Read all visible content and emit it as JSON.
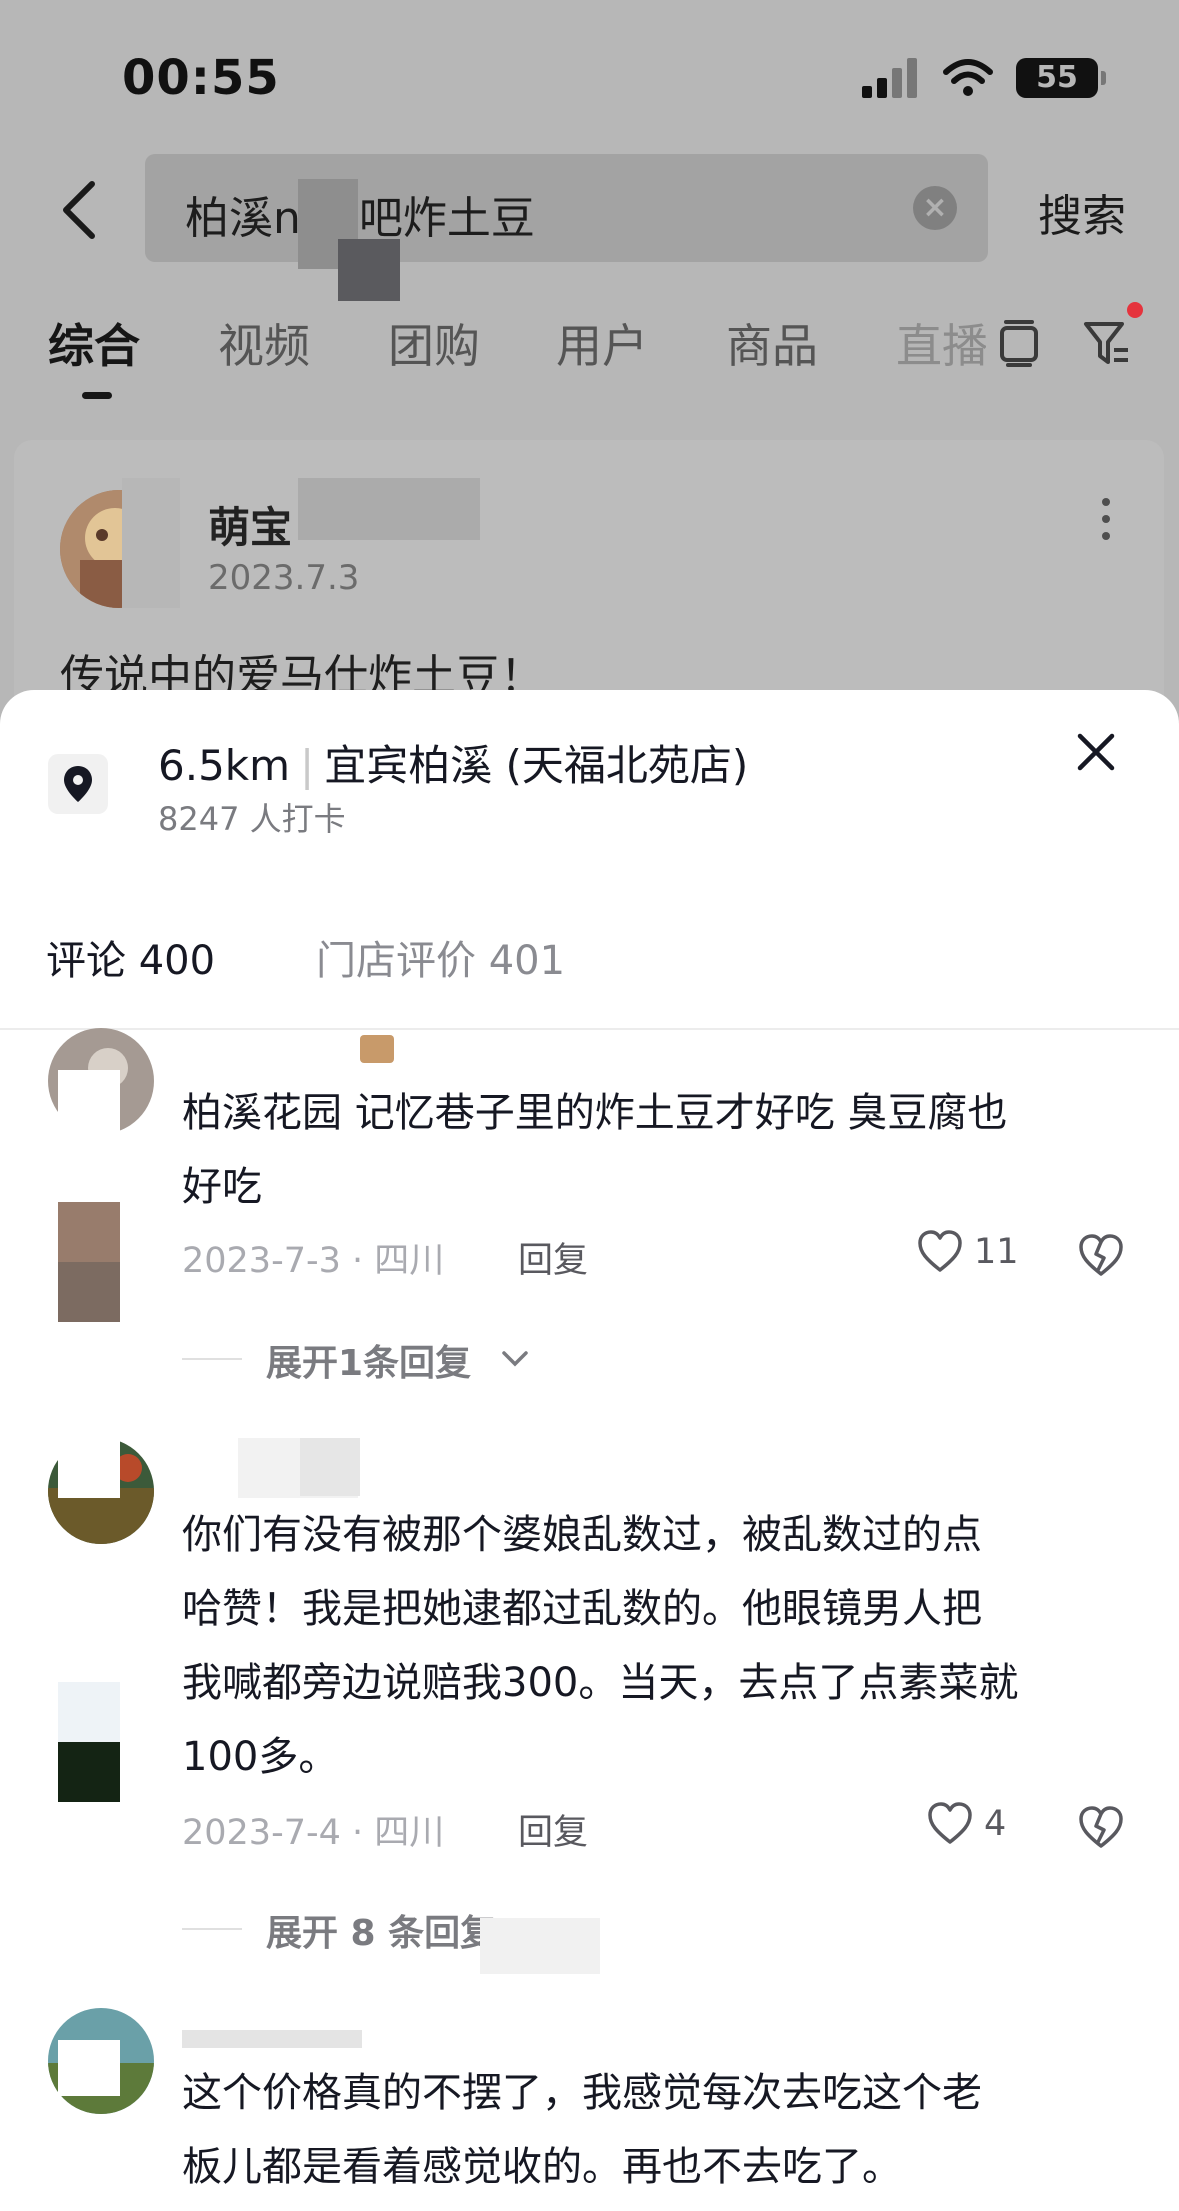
{
  "status_bar": {
    "time": "00:55",
    "battery": "55"
  },
  "search": {
    "query": "柏溪n      网吧炸土豆",
    "button": "搜索"
  },
  "tabs": [
    "综合",
    "视频",
    "团购",
    "用户",
    "商品",
    "直播"
  ],
  "card": {
    "name": "萌宝",
    "date": "2023.7.3",
    "text": "传说中的爱马仕炸土豆！"
  },
  "location": {
    "distance": "6.5km",
    "name": "宜宾柏溪 (天福北苑店)",
    "checkins": "8247 人打卡"
  },
  "sheet_tabs": {
    "comments": "评论 400",
    "reviews": "门店评价 401"
  },
  "comments": [
    {
      "lines": [
        "柏溪花园 记忆巷子里的炸土豆才好吃 臭豆腐也",
        "好吃"
      ],
      "meta": "2023-7-3 · 四川",
      "reply": "回复",
      "likes": "11",
      "expand": "展开1条回复"
    },
    {
      "lines": [
        "你们有没有被那个婆娘乱数过，被乱数过的点",
        "哈赞！我是把她逮都过乱数的。他眼镜男人把",
        "我喊都旁边说赔我300。当天，去点了点素菜就",
        "100多。"
      ],
      "meta": "2023-7-4 · 四川",
      "reply": "回复",
      "likes": "4",
      "expand": "展开 8 条回复"
    },
    {
      "lines": [
        "这个价格真的不摆了，我感觉每次去吃这个老",
        "板儿都是看着感觉收的。再也不去吃了。"
      ]
    }
  ]
}
